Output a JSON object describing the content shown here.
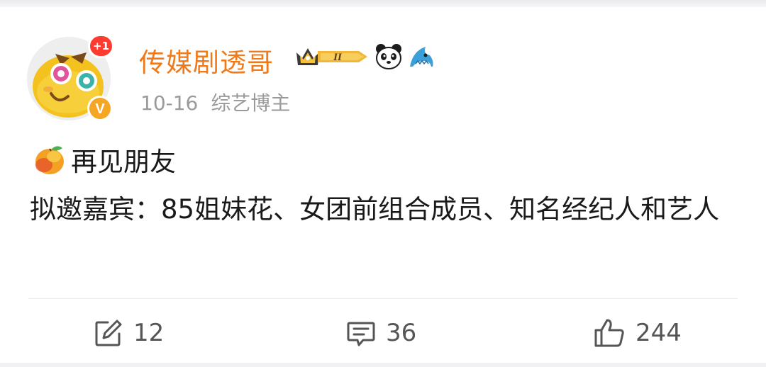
{
  "post": {
    "author": {
      "name": "传媒剧透哥",
      "avatar_badge": "+1",
      "verified_mark": "V",
      "level_badge": "II",
      "icons": [
        "crown-level-badge-icon",
        "panda-icon",
        "shark-icon",
        "verified-icon"
      ]
    },
    "meta": {
      "date": "10-16",
      "role": "综艺博主"
    },
    "title": "再见朋友",
    "content": "拟邀嘉宾：85姐妹花、女团前组合成员、知名经纪人和艺人",
    "actions": {
      "reposts": "12",
      "comments": "36",
      "likes": "244"
    }
  },
  "colors": {
    "username": "#f07a1a",
    "meta": "#9a9a9a",
    "text": "#1a1a1a",
    "badge_red": "#ff3b30",
    "verified_orange": "#f5a623"
  }
}
